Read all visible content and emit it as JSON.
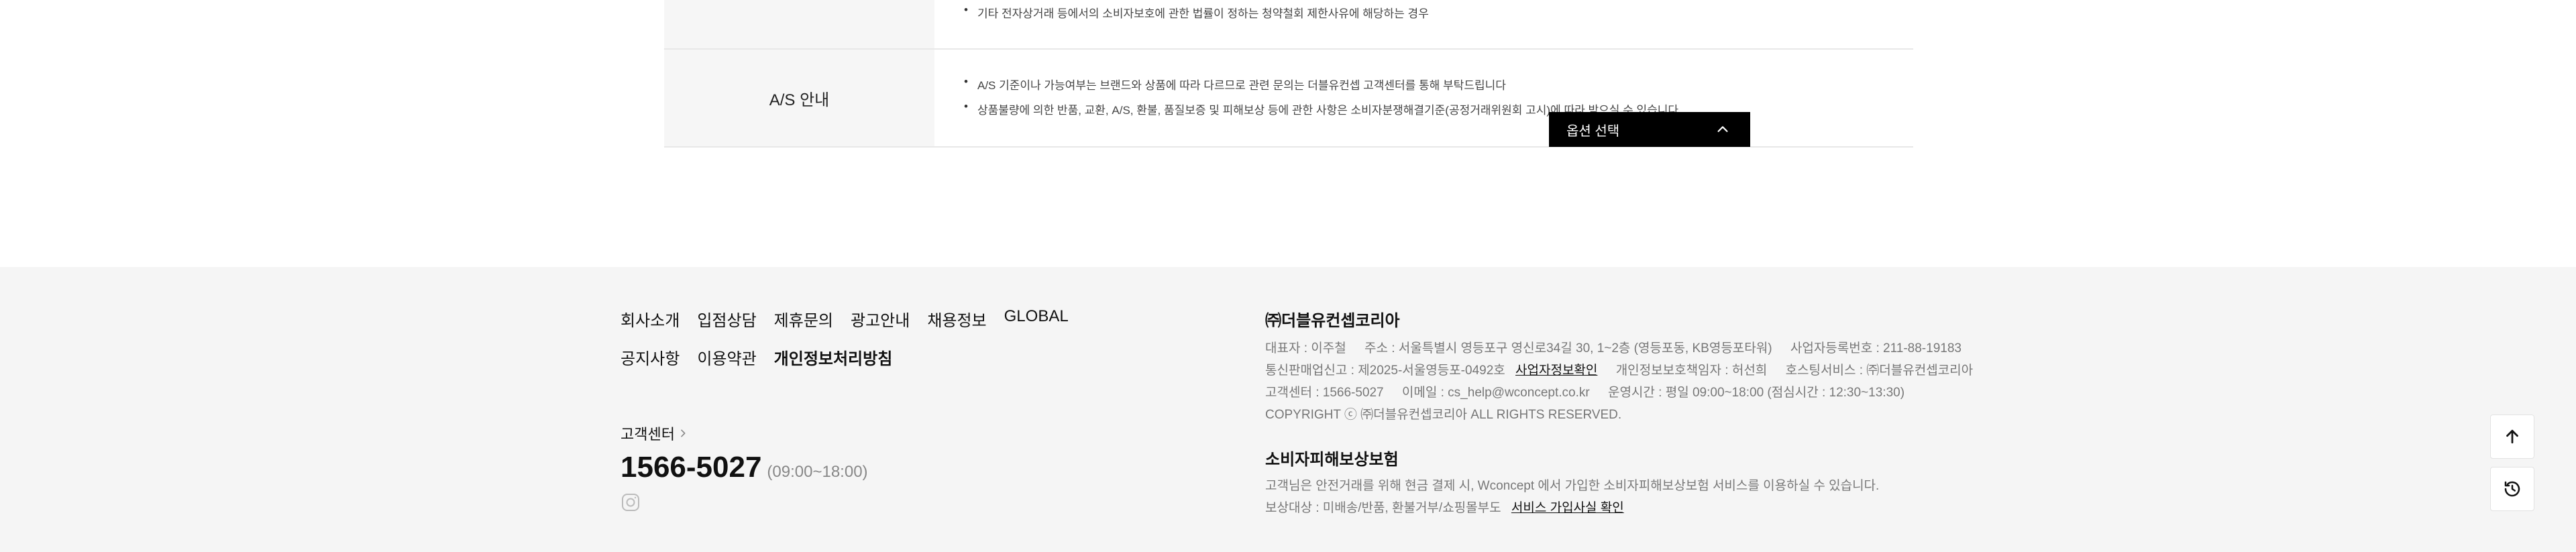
{
  "info_table": {
    "row1": {
      "bullet": "기타 전자상거래 등에서의 소비자보호에 관한 법률이 정하는 청약철회 제한사유에 해당하는 경우"
    },
    "row2": {
      "label": "A/S 안내",
      "bullets": [
        "A/S 기준이나 가능여부는 브랜드와 상품에 따라 다르므로 관련 문의는 더블유컨셉 고객센터를 통해 부탁드립니다",
        "상품불량에 의한 반품, 교환, A/S, 환불, 품질보증 및 피해보상 등에 관한 사항은 소비자분쟁해결기준(공정거래위원회 고시)에 따라 받으실 수 있습니다."
      ]
    }
  },
  "option_select": {
    "label": "옵션 선택",
    "icon": "chevron-up-icon"
  },
  "footer": {
    "links_row1": [
      "회사소개",
      "입점상담",
      "제휴문의",
      "광고안내",
      "채용정보",
      "GLOBAL"
    ],
    "links_row2": [
      "공지사항",
      "이용약관",
      "개인정보처리방침"
    ],
    "customer_center": {
      "title": "고객센터",
      "phone": "1566-5027",
      "hours": "(09:00~18:00)"
    },
    "company": {
      "name": "㈜더블유컨셉코리아",
      "ceo": "대표자 : 이주철",
      "address": "주소 : 서울특별시 영등포구 영신로34길 30, 1~2층 (영등포동, KB영등포타워)",
      "biz_no": "사업자등록번호 : 211-88-19183",
      "mail_order": "통신판매업신고 : 제2025-서울영등포-0492호",
      "biz_info_link": "사업자정보확인",
      "privacy_officer": "개인정보보호책임자 : 허선희",
      "hosting": "호스팅서비스 : ㈜더블유컨셉코리아",
      "cs_phone": "고객센터 : 1566-5027",
      "email": "이메일 : cs_help@wconcept.co.kr",
      "op_hours": "운영시간 : 평일 09:00~18:00 (점심시간 : 12:30~13:30)",
      "copyright": "COPYRIGHT ⓒ ㈜더블유컨셉코리아 ALL RIGHTS RESERVED."
    },
    "insurance": {
      "title": "소비자피해보상보험",
      "desc": "고객님은 안전거래를 위해 현금 결제 시, Wconcept 에서 가입한 소비자피해보상보험 서비스를 이용하실 수 있습니다.",
      "target": "보상대상 : 미배송/반품, 환불거부/쇼핑몰부도",
      "link": "서비스 가입사실 확인"
    }
  }
}
